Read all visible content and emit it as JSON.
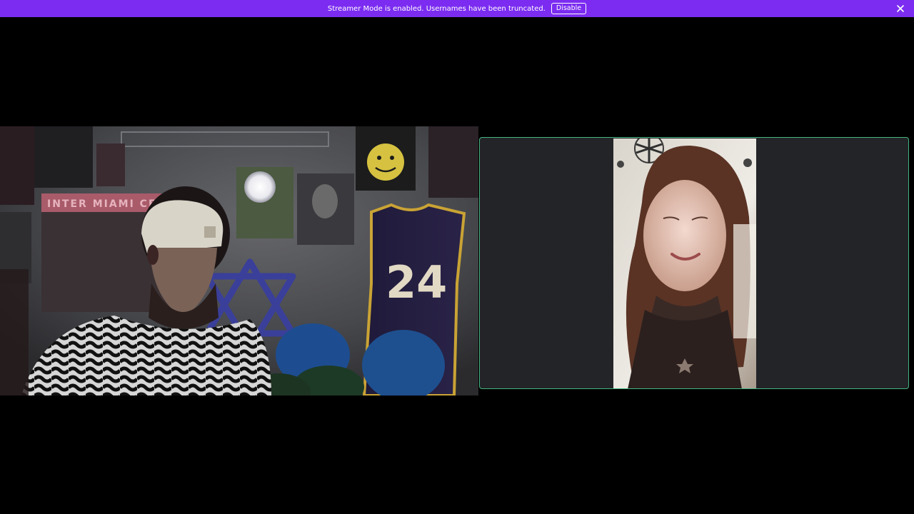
{
  "banner": {
    "message": "Streamer Mode is enabled. Usernames have been truncated.",
    "disable_label": "Disable",
    "close_icon": "close-icon",
    "color": "#7b2cf0"
  },
  "call": {
    "participants": [
      {
        "tile": "left",
        "video": "active"
      },
      {
        "tile": "right",
        "video": "active",
        "speaking": true,
        "speaking_ring_color": "#43b581"
      }
    ]
  }
}
